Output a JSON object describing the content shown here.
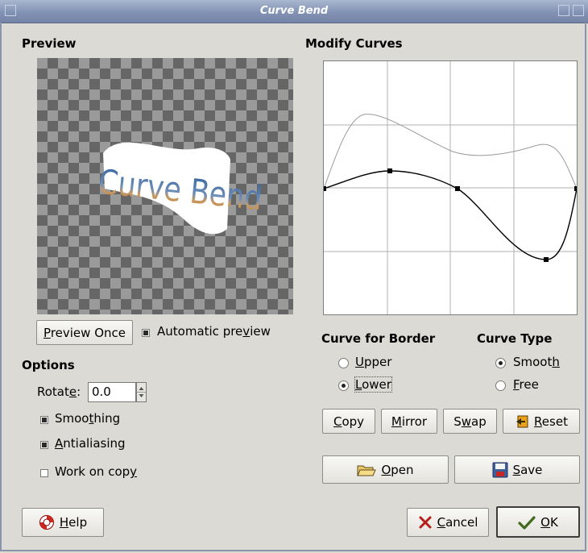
{
  "window": {
    "title": "Curve Bend"
  },
  "preview": {
    "heading": "Preview",
    "image_text": "Curve Bend",
    "preview_once_prefix": "",
    "preview_once_mnemonic": "P",
    "preview_once_rest": "review Once",
    "auto_preview_pre": "Automatic pre",
    "auto_preview_mnemonic": "v",
    "auto_preview_post": "iew",
    "auto_preview_checked": true
  },
  "options": {
    "heading": "Options",
    "rotate_pre": "Rotat",
    "rotate_mnemonic": "e",
    "rotate_post": ":",
    "rotate_value": "0.0",
    "smoothing_pre": "Smoo",
    "smoothing_mnemonic": "t",
    "smoothing_post": "hing",
    "smoothing_checked": true,
    "antialiasing_mnemonic": "A",
    "antialiasing_post": "ntialiasing",
    "antialiasing_checked": true,
    "work_on_copy_pre": "Work on cop",
    "work_on_copy_mnemonic": "y",
    "work_on_copy_checked": false
  },
  "curves": {
    "heading": "Modify Curves",
    "border_heading": "Curve for Border",
    "upper_mnemonic": "U",
    "upper_rest": "pper",
    "lower_mnemonic": "L",
    "lower_rest": "ower",
    "selected_border": "Lower",
    "type_heading": "Curve Type",
    "smooth_pre": "Smoot",
    "smooth_mnemonic": "h",
    "free_mnemonic": "F",
    "free_rest": "ree",
    "selected_type": "Smooth"
  },
  "buttons": {
    "copy_mnemonic": "C",
    "copy_rest": "opy",
    "mirror_mnemonic": "M",
    "mirror_rest": "irror",
    "swap_pre": "S",
    "swap_mnemonic": "w",
    "swap_post": "ap",
    "reset_mnemonic": "R",
    "reset_rest": "eset",
    "open_mnemonic": "O",
    "open_rest": "pen",
    "save_mnemonic": "S",
    "save_rest": "ave",
    "help_mnemonic": "H",
    "help_rest": "elp",
    "cancel_mnemonic": "C",
    "cancel_rest": "ancel",
    "ok_mnemonic": "O",
    "ok_rest": "K"
  },
  "colors": {
    "dialog_bg": "#dcdad5",
    "titlebar": "#8292b4",
    "lower_curve": "#000000",
    "upper_curve": "#9a9a9a"
  }
}
